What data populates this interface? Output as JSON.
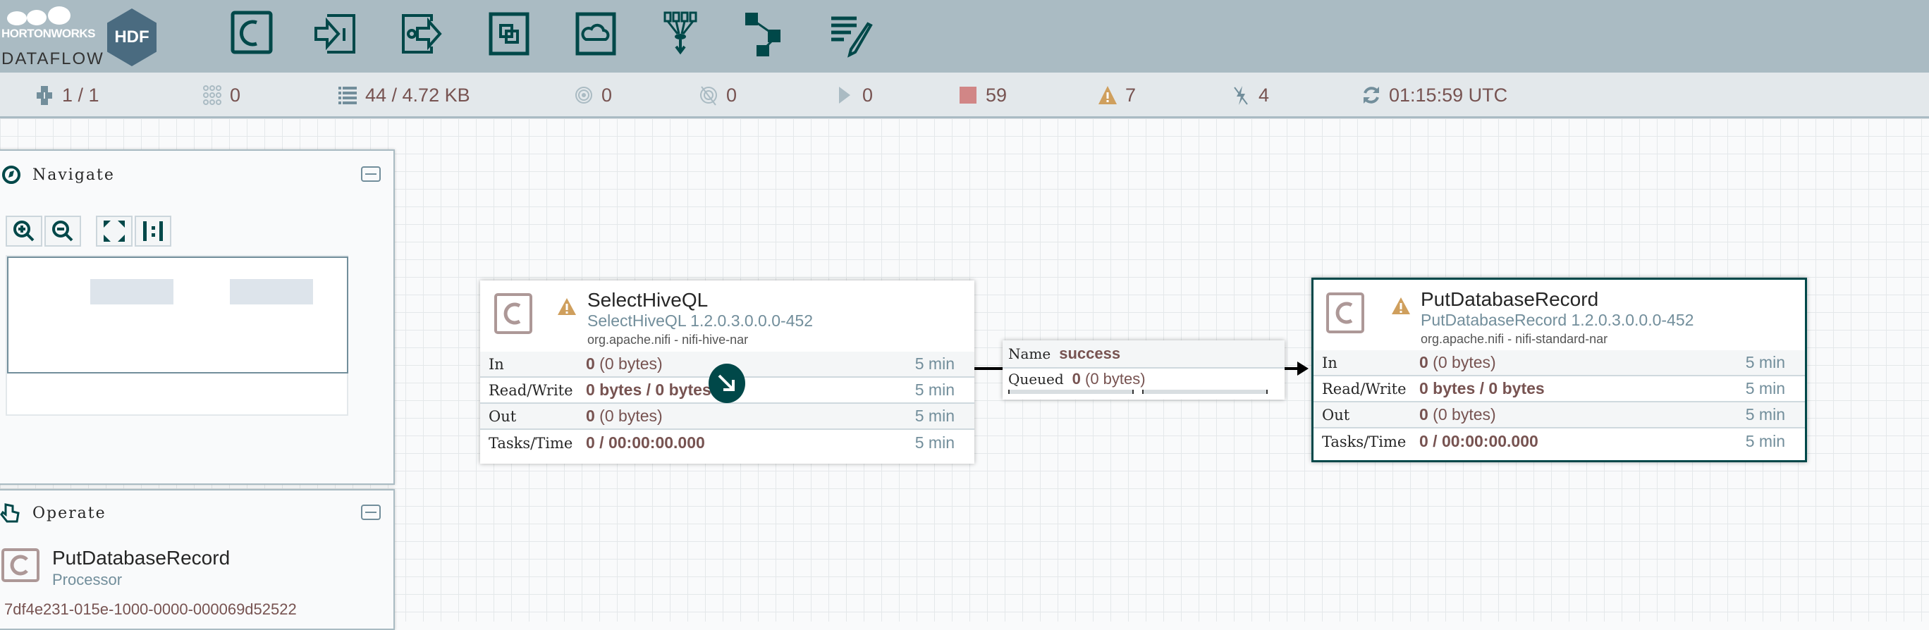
{
  "header": {
    "brand": "HORTONWORKS",
    "product": "DATAFLOW",
    "badge": "HDF",
    "toolbar": [
      {
        "name": "processor"
      },
      {
        "name": "input-port"
      },
      {
        "name": "output-port"
      },
      {
        "name": "process-group"
      },
      {
        "name": "remote-process-group"
      },
      {
        "name": "funnel"
      },
      {
        "name": "template"
      },
      {
        "name": "label"
      }
    ]
  },
  "status": {
    "transmitting": "1 / 1",
    "process_groups": "0",
    "queued": "44 / 4.72 KB",
    "transmitting_remote": "0",
    "not_transmitting": "0",
    "running": "0",
    "stopped": "59",
    "invalid": "7",
    "disabled": "4",
    "refreshed": "01:15:59 UTC"
  },
  "colors": {
    "accent": "#004849",
    "stopped": "#d18686",
    "warning": "#cf9f5d",
    "header_bg": "#aabbc3"
  },
  "navigate": {
    "title": "Navigate"
  },
  "operate": {
    "title": "Operate",
    "component_name": "PutDatabaseRecord",
    "component_type": "Processor",
    "component_id": "7df4e231-015e-1000-0000-000069d52522"
  },
  "processors": [
    {
      "name": "SelectHiveQL",
      "type": "SelectHiveQL 1.2.0.3.0.0.0-452",
      "bundle": "org.apache.nifi - nifi-hive-nar",
      "rows": [
        {
          "label": "In",
          "value": "0",
          "detail": " (0 bytes)",
          "time": "5 min"
        },
        {
          "label": "Read/Write",
          "value": "0 bytes / 0 bytes",
          "detail": "",
          "time": "5 min"
        },
        {
          "label": "Out",
          "value": "0",
          "detail": " (0 bytes)",
          "time": "5 min"
        },
        {
          "label": "Tasks/Time",
          "value": "0 / 00:00:00.000",
          "detail": "",
          "time": "5 min"
        }
      ]
    },
    {
      "name": "PutDatabaseRecord",
      "type": "PutDatabaseRecord 1.2.0.3.0.0.0-452",
      "bundle": "org.apache.nifi - nifi-standard-nar",
      "rows": [
        {
          "label": "In",
          "value": "0",
          "detail": " (0 bytes)",
          "time": "5 min"
        },
        {
          "label": "Read/Write",
          "value": "0 bytes / 0 bytes",
          "detail": "",
          "time": "5 min"
        },
        {
          "label": "Out",
          "value": "0",
          "detail": " (0 bytes)",
          "time": "5 min"
        },
        {
          "label": "Tasks/Time",
          "value": "0 / 00:00:00.000",
          "detail": "",
          "time": "5 min"
        }
      ]
    }
  ],
  "connection": {
    "name_label": "Name",
    "name": "success",
    "queued_label": "Queued",
    "queued_count": "0",
    "queued_size": " (0 bytes)"
  }
}
